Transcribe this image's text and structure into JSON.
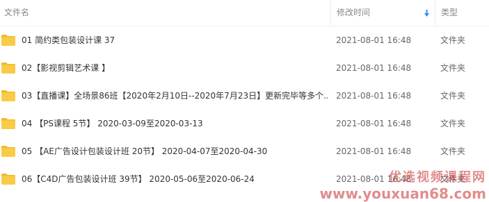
{
  "header": {
    "name_label": "文件名",
    "date_label": "修改时间",
    "type_label": "类型",
    "sort_icon": "sort-down-arrow-icon"
  },
  "colors": {
    "folder": "#f9cc47",
    "folder_tab": "#f2b92c",
    "sort_arrow": "#2c8ef8",
    "watermark": "#c82d2d"
  },
  "files": [
    {
      "name": "01 简约类包装设计课 37",
      "date": "2021-08-01 16:48",
      "type": "文件夹",
      "icon": "folder-icon"
    },
    {
      "name": "02【影视剪辑艺术课 】",
      "date": "2021-08-01 16:48",
      "type": "文件夹",
      "icon": "folder-icon"
    },
    {
      "name": "03【直播课】全场景86班【2020年2月10日--2020年7月23日】更新完毕等多个...",
      "date": "2021-08-01 16:48",
      "type": "文件夹",
      "icon": "folder-icon"
    },
    {
      "name": "04 【PS课程 5节】 2020-03-09至2020-03-13",
      "date": "2021-08-01 16:48",
      "type": "文件夹",
      "icon": "folder-icon"
    },
    {
      "name": "05 【AE广告设计包装设计班 20节】 2020-04-07至2020-04-30",
      "date": "2021-08-01 16:48",
      "type": "文件夹",
      "icon": "folder-icon"
    },
    {
      "name": "06【C4D广告包装设计班 39节】 2020-05-06至2020-06-24",
      "date": "2021-08-01 16:48",
      "type": "文件夹",
      "icon": "folder-icon"
    }
  ],
  "watermark": {
    "title": "优选视频课程网",
    "url": "www.youxuan68.com"
  }
}
